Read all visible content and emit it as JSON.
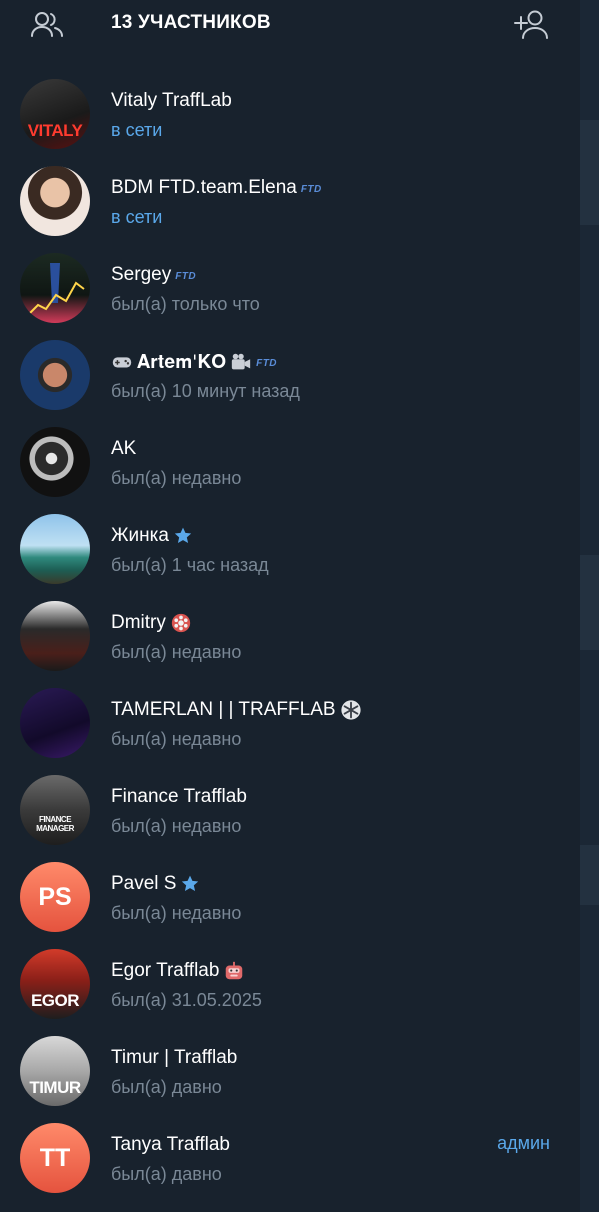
{
  "header": {
    "title": "13 УЧАСТНИКОВ"
  },
  "members": [
    {
      "name": "Vitaly TraffLab",
      "status": "в сети",
      "avatar_text": "VITALY"
    },
    {
      "name": "BDM FTD.team.Elena",
      "status": "в сети",
      "badge": "FTD"
    },
    {
      "name": "Sergey",
      "status": "был(а) только что",
      "badge": "FTD"
    },
    {
      "name": "𝐀𝐫𝐭𝐞𝐦'𝐊𝐎",
      "status": "был(а) 10 минут назад",
      "badge": "FTD"
    },
    {
      "name": "AK",
      "status": "был(а) недавно"
    },
    {
      "name": "Жинка",
      "status": "был(а) 1 час назад"
    },
    {
      "name": "Dmitry",
      "status": "был(а) недавно"
    },
    {
      "name": "TAMERLAN | | TRAFFLAB",
      "status": "был(а) недавно"
    },
    {
      "name": "Finance Trafflab",
      "status": "был(а) недавно",
      "avatar_text": "FINANCE MANAGER"
    },
    {
      "name": "Pavel S",
      "status": "был(а) недавно",
      "initials": "PS"
    },
    {
      "name": "Egor Trafflab",
      "status": "был(а) 31.05.2025",
      "avatar_text": "EGOR"
    },
    {
      "name": "Timur | Trafflab",
      "status": "был(а) давно",
      "avatar_text": "TIMUR"
    },
    {
      "name": "Tanya Trafflab",
      "status": "был(а) давно",
      "initials": "TT",
      "role": "админ"
    }
  ],
  "colors": {
    "panel_bg": "#18222d",
    "accent": "#5aa8ea",
    "muted": "#7a8896",
    "initials_avatar": "#e5533e"
  }
}
